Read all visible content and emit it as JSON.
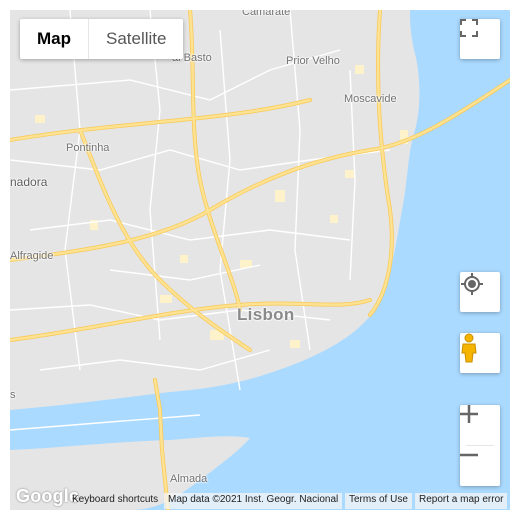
{
  "map": {
    "maptype": {
      "map_label": "Map",
      "satellite_label": "Satellite",
      "selected": "Map"
    },
    "labels": {
      "camarate": "Camarate",
      "alto_basto": "al Basto",
      "prior_velho": "Prior Velho",
      "moscavide": "Moscavide",
      "pontinha": "Pontinha",
      "amadora": "nadora",
      "alfragide": "Alfragide",
      "lisbon": "Lisbon",
      "almada": "Almada",
      "edge_s": "s"
    },
    "colors": {
      "land": "#e5e5e5",
      "water": "#aadaff",
      "road_major": "#fde293",
      "road_major_edge": "#f9c953",
      "road_minor": "#ffffff",
      "urban": "#fdf2c9"
    },
    "controls": {
      "fullscreen_icon": "fullscreen-icon",
      "location_icon": "my-location-icon",
      "pegman_icon": "pegman-icon",
      "zoom_in_icon": "zoom-in-icon",
      "zoom_out_icon": "zoom-out-icon"
    },
    "footer": {
      "logo": "Google",
      "keyboard": "Keyboard shortcuts",
      "map_data": "Map data ©2021 Inst. Geogr. Nacional",
      "terms": "Terms of Use",
      "report": "Report a map error"
    }
  }
}
